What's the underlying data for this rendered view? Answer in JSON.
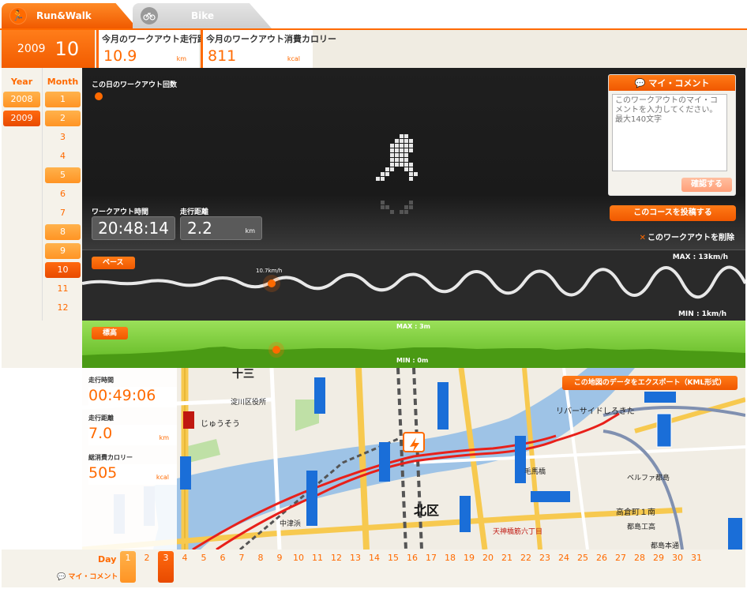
{
  "tabs": {
    "run": "Run&Walk",
    "bike": "Bike"
  },
  "header": {
    "year": "2009",
    "month": "10",
    "monthly_distance_label": "今月のワークアウト走行距離",
    "monthly_distance_value": "10.9",
    "monthly_distance_unit": "km",
    "monthly_calorie_label": "今月のワークアウト消費カロリー",
    "monthly_calorie_value": "811",
    "monthly_calorie_unit": "kcal"
  },
  "nav": {
    "year_head": "Year",
    "month_head": "Month",
    "years": [
      {
        "label": "2008",
        "state": "avail"
      },
      {
        "label": "2009",
        "state": "sel"
      }
    ],
    "months": [
      {
        "label": "1",
        "state": "avail"
      },
      {
        "label": "2",
        "state": "avail"
      },
      {
        "label": "3",
        "state": "dim"
      },
      {
        "label": "4",
        "state": "dim"
      },
      {
        "label": "5",
        "state": "avail"
      },
      {
        "label": "6",
        "state": "dim"
      },
      {
        "label": "7",
        "state": "dim"
      },
      {
        "label": "8",
        "state": "avail"
      },
      {
        "label": "9",
        "state": "avail"
      },
      {
        "label": "10",
        "state": "sel"
      },
      {
        "label": "11",
        "state": "dim"
      },
      {
        "label": "12",
        "state": "dim"
      }
    ]
  },
  "workout": {
    "count_label": "この日のワークアウト回数",
    "time_label": "ワークアウト時間",
    "time_value": "20:48:14",
    "distance_label": "走行距離",
    "distance_value": "2.2",
    "distance_unit": "km"
  },
  "comment": {
    "title": "マイ・コメント",
    "placeholder": "このワークアウトのマイ・コメントを入力してください。最大140文字",
    "confirm": "確認する"
  },
  "actions": {
    "post_course": "このコースを投稿する",
    "delete_workout": "このワークアウトを削除",
    "export_map": "この地図のデータをエクスポート（KML形式）"
  },
  "pace": {
    "label": "ペース",
    "max": "MAX : 13km/h",
    "min": "MIN : 1km/h",
    "current": "10.7km/h"
  },
  "elevation": {
    "label": "標高",
    "max": "MAX : 3m",
    "min": "MIN : 0m"
  },
  "map_stats": {
    "time_label": "走行時間",
    "time_value": "00:49:06",
    "distance_label": "走行距離",
    "distance_value": "7.0",
    "distance_unit": "km",
    "calorie_label": "総消費カロリー",
    "calorie_value": "505",
    "calorie_unit": "kcal"
  },
  "map_labels": {
    "kita_ku": "北区",
    "jusou": "十三",
    "juso_hiragana": "じゅうそう",
    "yodogawa_office": "淀川区役所",
    "riverside": "リバーサイドしろきた",
    "takakuracho": "高倉町１南",
    "miyakojima_tokoro": "都島区役所",
    "miyakojima_koko": "都島工高",
    "miyakojima_motomachi": "都島本通",
    "umeda": "梅田",
    "nakatsu": "中津浜",
    "tenjinbashi": "天神橋筋六丁目",
    "bellfa": "ベルファ都島",
    "kemahashi": "毛馬橋"
  },
  "days": {
    "label": "Day",
    "legend": "マイ・コメント",
    "items": [
      {
        "label": "1",
        "state": "avail"
      },
      {
        "label": "2",
        "state": "dim"
      },
      {
        "label": "3",
        "state": "sel"
      },
      {
        "label": "4",
        "state": "dim"
      },
      {
        "label": "5",
        "state": "dim"
      },
      {
        "label": "6",
        "state": "dim"
      },
      {
        "label": "7",
        "state": "dim"
      },
      {
        "label": "8",
        "state": "dim"
      },
      {
        "label": "9",
        "state": "dim"
      },
      {
        "label": "10",
        "state": "dim"
      },
      {
        "label": "11",
        "state": "dim"
      },
      {
        "label": "12",
        "state": "dim"
      },
      {
        "label": "13",
        "state": "dim"
      },
      {
        "label": "14",
        "state": "dim"
      },
      {
        "label": "15",
        "state": "dim"
      },
      {
        "label": "16",
        "state": "dim"
      },
      {
        "label": "17",
        "state": "dim"
      },
      {
        "label": "18",
        "state": "dim"
      },
      {
        "label": "19",
        "state": "dim"
      },
      {
        "label": "20",
        "state": "dim"
      },
      {
        "label": "21",
        "state": "dim"
      },
      {
        "label": "22",
        "state": "dim"
      },
      {
        "label": "23",
        "state": "dim"
      },
      {
        "label": "24",
        "state": "dim"
      },
      {
        "label": "25",
        "state": "dim"
      },
      {
        "label": "26",
        "state": "dim"
      },
      {
        "label": "27",
        "state": "dim"
      },
      {
        "label": "28",
        "state": "dim"
      },
      {
        "label": "29",
        "state": "dim"
      },
      {
        "label": "30",
        "state": "dim"
      },
      {
        "label": "31",
        "state": "dim"
      }
    ]
  },
  "colors": {
    "accent": "#ff6a00",
    "accent_light": "#ffa63a",
    "dark_panel": "#1f1f1f",
    "elevation_green": "#6ec42a",
    "route_red": "#e8201a"
  }
}
